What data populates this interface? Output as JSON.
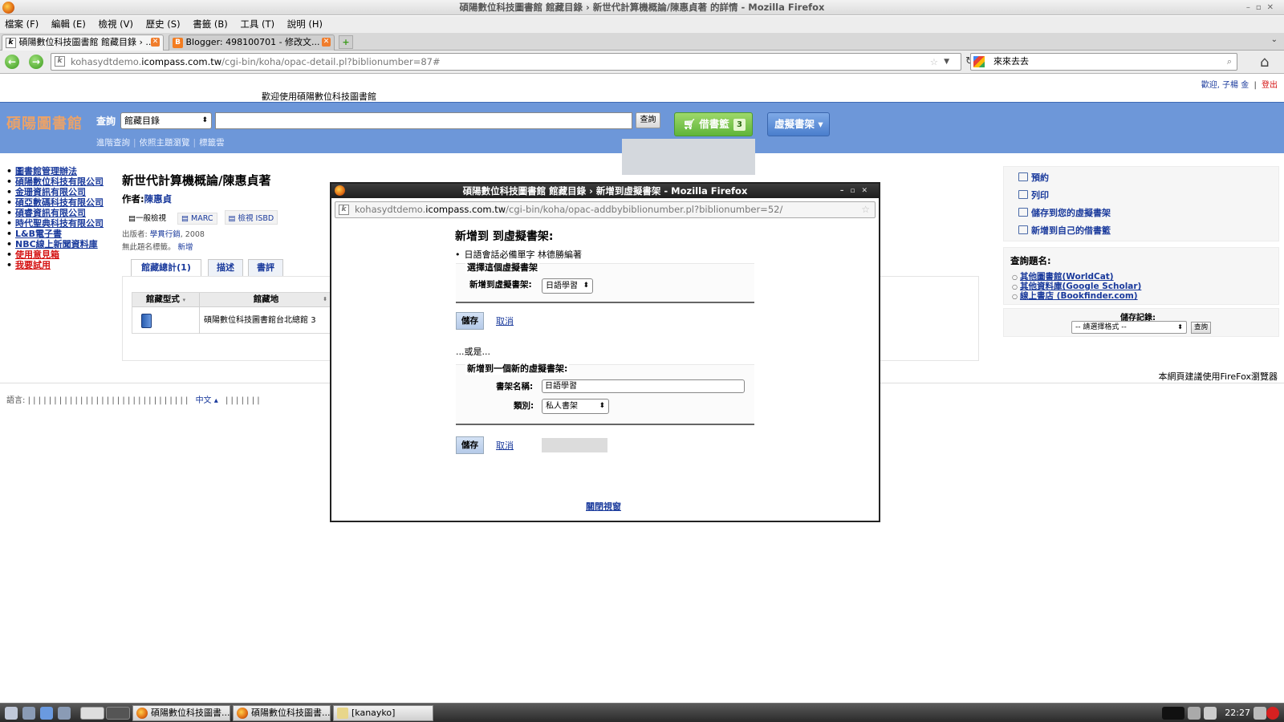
{
  "browser": {
    "window_title": "碩陽數位科技圖書館 館藏目錄 › 新世代計算機概論/陳惠貞著 的詳情 - Mozilla Firefox",
    "menu": [
      "檔案 (F)",
      "編輯 (E)",
      "檢視 (V)",
      "歷史 (S)",
      "書籤 (B)",
      "工具 (T)",
      "說明 (H)"
    ],
    "tabs": [
      {
        "label": "碩陽數位科技圖書館 館藏目錄 › ...",
        "active": true
      },
      {
        "label": "Blogger: 498100701 - 修改文...",
        "active": false
      }
    ],
    "url_prefix": "kohasydtdemo.",
    "url_host": "icompass.com.tw",
    "url_path": "/cgi-bin/koha/opac-detail.pl?biblionumber=87#",
    "search_value": "來來去去"
  },
  "opac": {
    "top_right_user": "歡迎, 子楊 金",
    "top_right_logout": "登出",
    "welcome": "歡迎使用碩陽數位科技圖書館",
    "logo": "碩陽圖書館",
    "search_label": "查詢",
    "search_scope": "館藏目錄",
    "search_button": "查詢",
    "cart_label": "借書籃",
    "cart_count": "3",
    "lists_label": "虛擬書架 ▾",
    "sublinks": [
      "進階查詢",
      "依照主題瀏覽",
      "標籤雲"
    ],
    "left_nav": [
      {
        "label": "圖書館管理辦法",
        "color": "blue"
      },
      {
        "label": "碩陽數位科技有限公司",
        "color": "blue"
      },
      {
        "label": "金珊資訊有限公司",
        "color": "blue"
      },
      {
        "label": "碩亞數碼科技有限公司",
        "color": "blue"
      },
      {
        "label": "碩睿資訊有限公司",
        "color": "blue"
      },
      {
        "label": "時代聖典科技有限公司",
        "color": "blue"
      },
      {
        "label": "L&B電子書",
        "color": "blue"
      },
      {
        "label": "NBC線上新聞資料庫",
        "color": "blue"
      },
      {
        "label": "使用意見箱",
        "color": "red"
      },
      {
        "label": "我要試用",
        "color": "red"
      }
    ],
    "book_title": "新世代計算機概論/陳惠貞著",
    "author_label": "作者:",
    "author_name": "陳惠貞",
    "view_tabs": [
      "一般檢視",
      "MARC",
      "檢視 ISBD"
    ],
    "publisher_label": "出版者:",
    "publisher": "學貫行銷",
    "pub_year": ", 2008",
    "no_subject": "無此題名標籤。",
    "add_tag": "新增",
    "holding_tabs": [
      "館藏總計(1)",
      "描述",
      "書評"
    ],
    "holdings_headers": [
      "館藏型式",
      "館藏地"
    ],
    "holdings_location": "碩陽數位科技圖書館台北總館",
    "holdings_extra": "3",
    "actions": [
      "預約",
      "列印",
      "儲存到您的虛擬書架",
      "新增到自己的借書籃"
    ],
    "search_title_heading": "查詢題名:",
    "search_title_links": [
      "其他圖書館(WorldCat)",
      "其他資料庫(Google Scholar)",
      "線上書店 (Bookfinder.com)"
    ],
    "save_record_label": "儲存記錄:",
    "save_record_select": "-- 請選擇格式 --",
    "save_record_go": "查詢",
    "firefox_note": "本網頁建議使用FireFox瀏覽器",
    "language_label": "語言:",
    "language_bars": "| | | | | | | | | | | | | | | | | | | | | | | | | | | | | | |",
    "language_current": "中文 ▴",
    "language_bars2": "| | | | | | |"
  },
  "popup": {
    "title": "碩陽數位科技圖書館 館藏目錄 › 新增到虛擬書架 - Mozilla Firefox",
    "url_prefix": "kohasydtdemo.",
    "url_host": "icompass.com.tw",
    "url_path": "/cgi-bin/koha/opac-addbybiblionumber.pl?biblionumber=52/",
    "heading": "新增到 到虛擬書架:",
    "book": "日語會話必備單字 林德勝編著",
    "fs1_legend": "選擇這個虛擬書架",
    "fs1_label": "新增到虛擬書架:",
    "fs1_select": "日語學習",
    "save": "儲存",
    "cancel": "取消",
    "or_text": "...或是...",
    "fs2_legend": "新增到一個新的虛擬書架:",
    "shelf_name_label": "書架名稱:",
    "shelf_name_value": "日語學習",
    "category_label": "類別:",
    "category_value": "私人書架",
    "close": "關閉視窗"
  },
  "taskbar": {
    "tasks": [
      "碩陽數位科技圖書...",
      "碩陽數位科技圖書...",
      "[kanayko]"
    ],
    "clock": "22:27"
  }
}
